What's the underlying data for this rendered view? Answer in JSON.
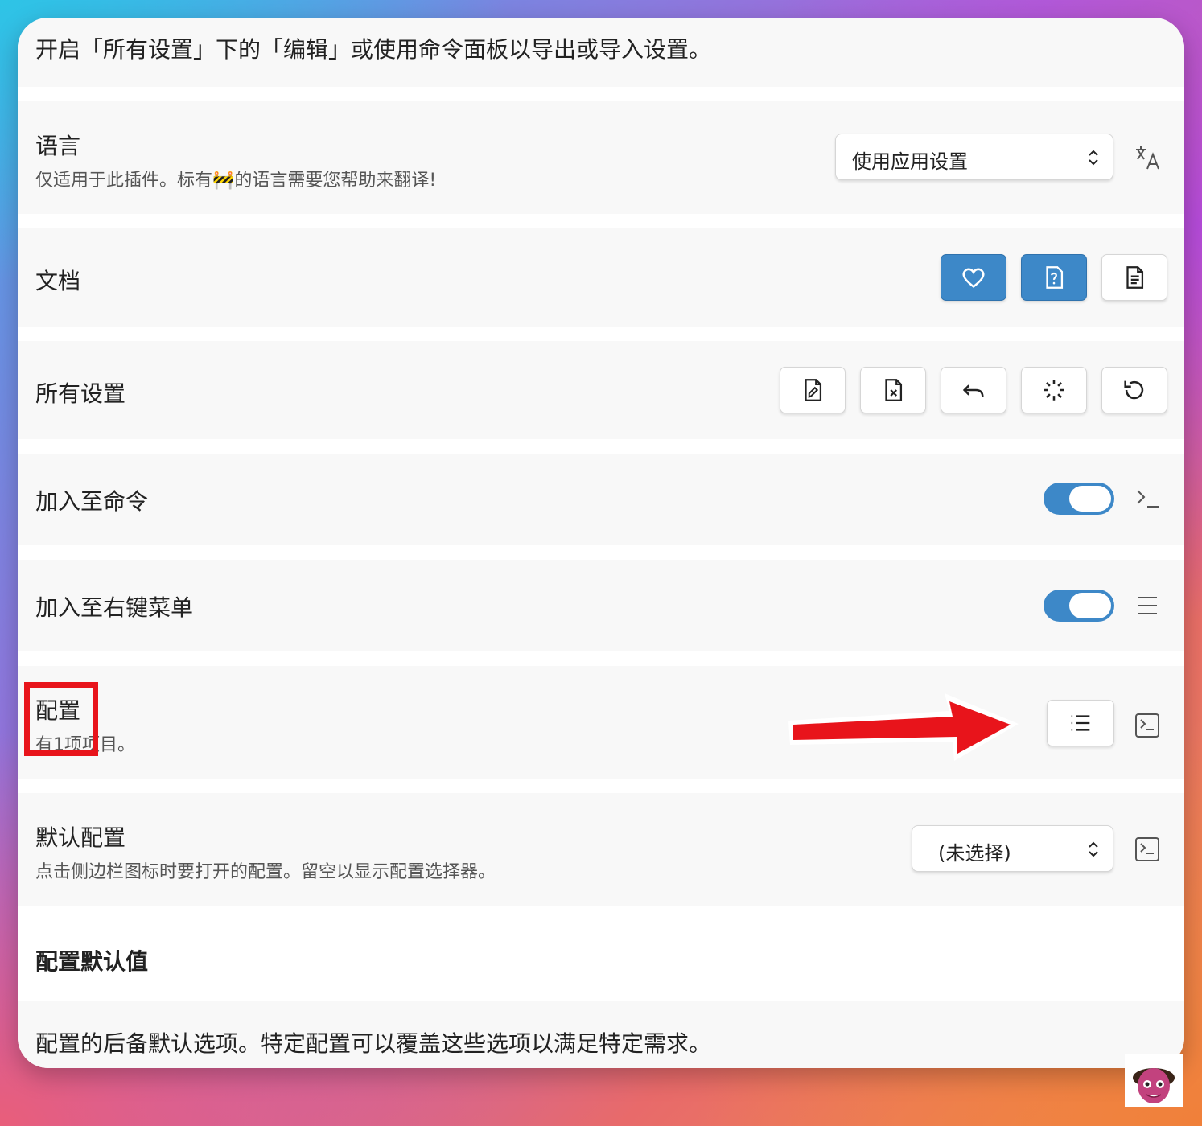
{
  "intro": {
    "text": "开启「所有设置」下的「编辑」或使用命令面板以导出或导入设置。"
  },
  "language": {
    "title": "语言",
    "desc": "仅适用于此插件。标有🚧的语言需要您帮助来翻译!",
    "select_value": "使用应用设置",
    "icon": "translate-icon"
  },
  "docs": {
    "title": "文档",
    "buttons": [
      "heart-icon",
      "help-file-icon",
      "document-icon"
    ],
    "accent": "#3d88c8"
  },
  "all_settings": {
    "title": "所有设置",
    "buttons": [
      "edit-file-icon",
      "delete-file-icon",
      "undo-icon",
      "loader-icon",
      "reset-icon"
    ]
  },
  "add_command": {
    "title": "加入至命令",
    "toggle_on": true,
    "icon": "terminal-icon"
  },
  "add_context_menu": {
    "title": "加入至右键菜单",
    "toggle_on": true,
    "icon": "menu-icon"
  },
  "profiles": {
    "title": "配置",
    "desc": "有1项项目。",
    "button_icon": "list-icon",
    "icon": "terminal-square-icon",
    "highlight_color": "#e8141b",
    "arrow_color": "#e8141b"
  },
  "default_profile": {
    "title": "默认配置",
    "desc": "点击侧边栏图标时要打开的配置。留空以显示配置选择器。",
    "select_value": "(未选择)",
    "icon": "terminal-square-icon"
  },
  "profile_defaults": {
    "heading": "配置默认值",
    "desc": "配置的后备默认选项。特定配置可以覆盖这些选项以满足特定需求。"
  }
}
